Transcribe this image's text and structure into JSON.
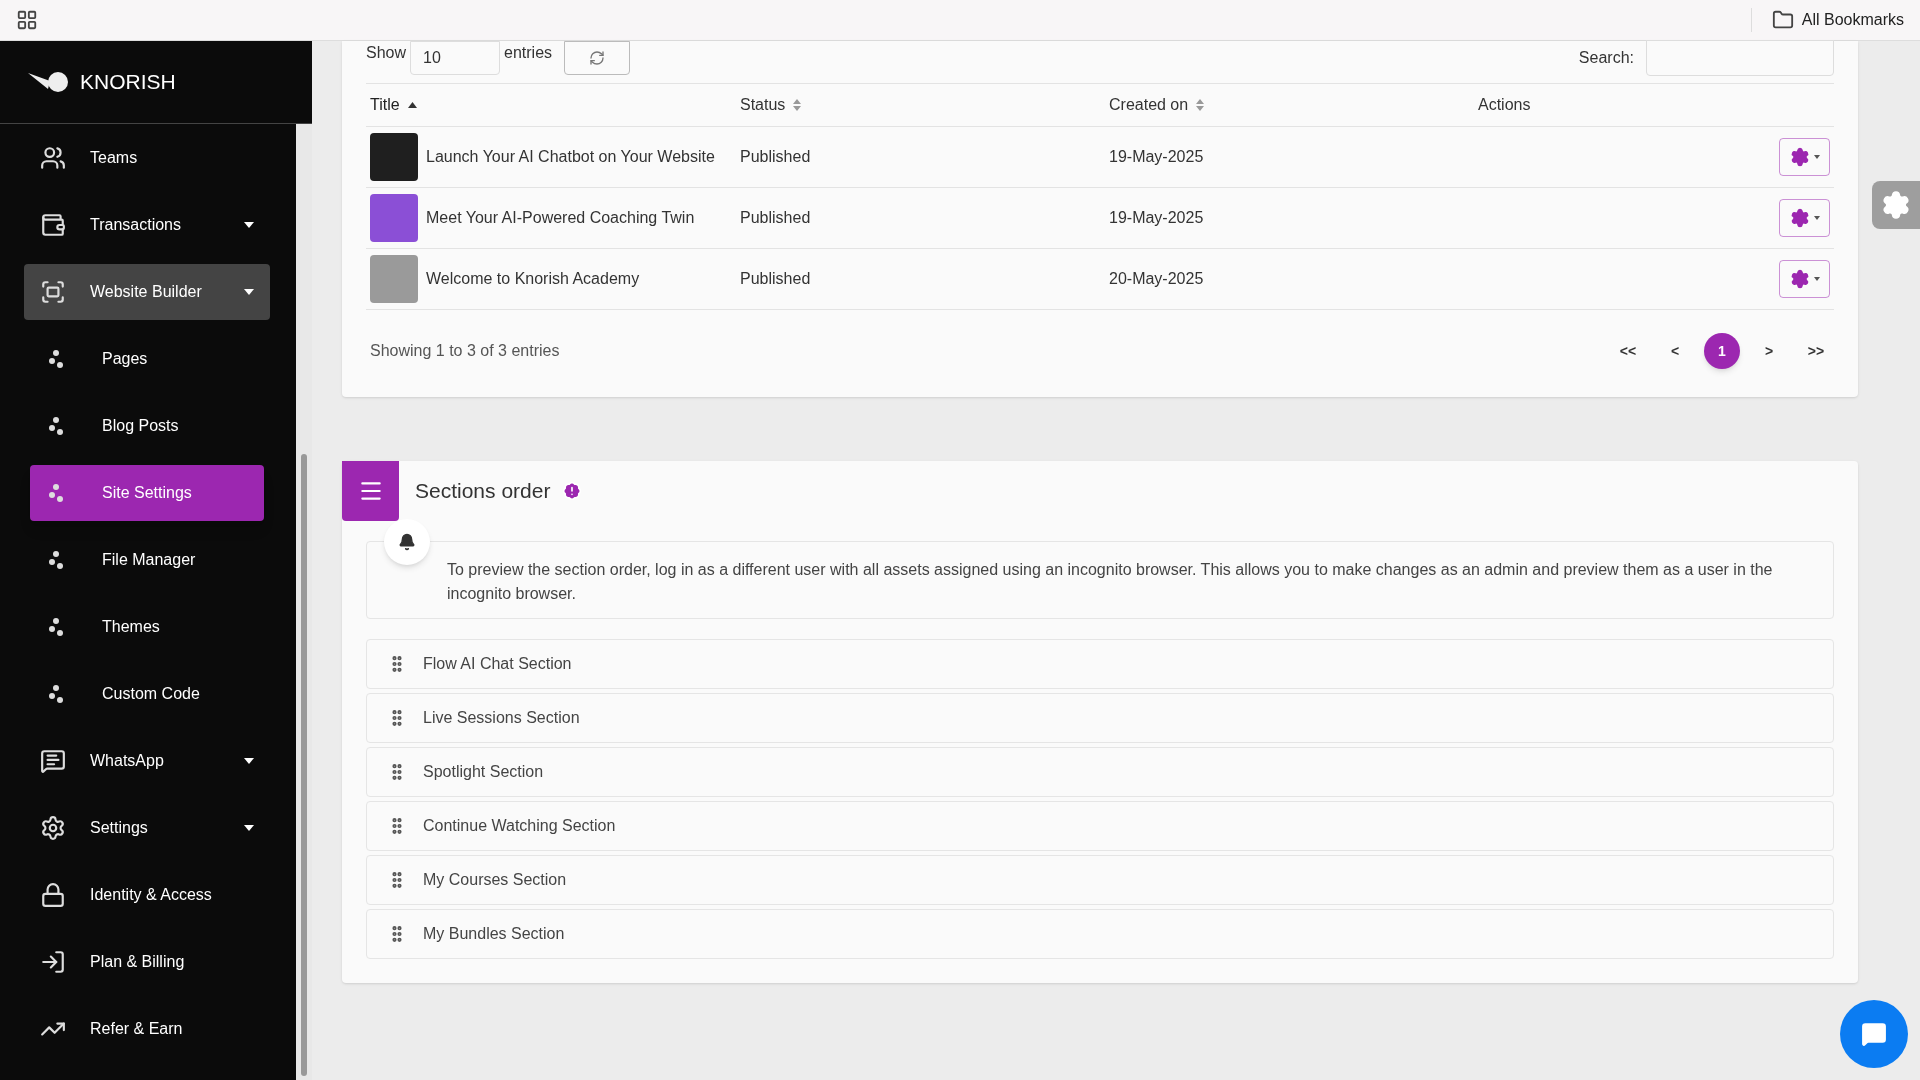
{
  "topbar": {
    "bookmarks": "All Bookmarks"
  },
  "sidebar": {
    "brand": "KNORISH",
    "items": [
      {
        "label": "Teams",
        "kind": "main",
        "dropdown": false,
        "expanded": false,
        "selected": false
      },
      {
        "label": "Transactions",
        "kind": "main",
        "dropdown": true,
        "expanded": false,
        "selected": false
      },
      {
        "label": "Website Builder",
        "kind": "main",
        "dropdown": true,
        "expanded": true,
        "selected": false
      },
      {
        "label": "Pages",
        "kind": "sub",
        "selected": false
      },
      {
        "label": "Blog Posts",
        "kind": "sub",
        "selected": false
      },
      {
        "label": "Site Settings",
        "kind": "sub",
        "selected": true
      },
      {
        "label": "File Manager",
        "kind": "sub",
        "selected": false
      },
      {
        "label": "Themes",
        "kind": "sub",
        "selected": false
      },
      {
        "label": "Custom Code",
        "kind": "sub",
        "selected": false
      },
      {
        "label": "WhatsApp",
        "kind": "main",
        "dropdown": true,
        "expanded": false,
        "selected": false
      },
      {
        "label": "Settings",
        "kind": "main",
        "dropdown": true,
        "expanded": false,
        "selected": false
      },
      {
        "label": "Identity & Access",
        "kind": "main",
        "dropdown": false,
        "expanded": false,
        "selected": false
      },
      {
        "label": "Plan & Billing",
        "kind": "main",
        "dropdown": false,
        "expanded": false,
        "selected": false
      },
      {
        "label": "Refer & Earn",
        "kind": "main",
        "dropdown": false,
        "expanded": false,
        "selected": false
      }
    ]
  },
  "table": {
    "show_label": "Show",
    "page_length": "10",
    "entries_label": "entries",
    "search_label": "Search:",
    "columns": [
      {
        "label": "Title",
        "sortable": true,
        "sorted": true
      },
      {
        "label": "Status",
        "sortable": true,
        "sorted": false
      },
      {
        "label": "Created on",
        "sortable": true,
        "sorted": false
      },
      {
        "label": "Actions",
        "sortable": false,
        "sorted": false
      }
    ],
    "rows": [
      {
        "title": "Launch Your AI Chatbot on Your Website",
        "status": "Published",
        "created": "19-May-2025",
        "color": "#1f1f1f"
      },
      {
        "title": "Meet Your AI-Powered Coaching Twin",
        "status": "Published",
        "color": "#8b4fd6",
        "created": "19-May-2025"
      },
      {
        "title": "Welcome to Knorish Academy",
        "status": "Published",
        "created": "20-May-2025",
        "color": "#9a9a9a"
      }
    ],
    "info": "Showing 1 to 3 of 3 entries",
    "pagination": [
      {
        "label": "<<",
        "selected": false
      },
      {
        "label": "<",
        "selected": false
      },
      {
        "label": "1",
        "selected": true
      },
      {
        "label": ">",
        "selected": false
      },
      {
        "label": ">>",
        "selected": false
      }
    ]
  },
  "sections": {
    "title": "Sections order",
    "notice": "To preview the section order, log in as a different user with all assets assigned using an incognito browser. This allows you to make changes as an admin and preview them as a user in the incognito browser.",
    "items": [
      "Flow AI Chat Section",
      "Live Sessions Section",
      "Spotlight Section",
      "Continue Watching Section",
      "My Courses Section",
      "My Bundles Section"
    ]
  }
}
